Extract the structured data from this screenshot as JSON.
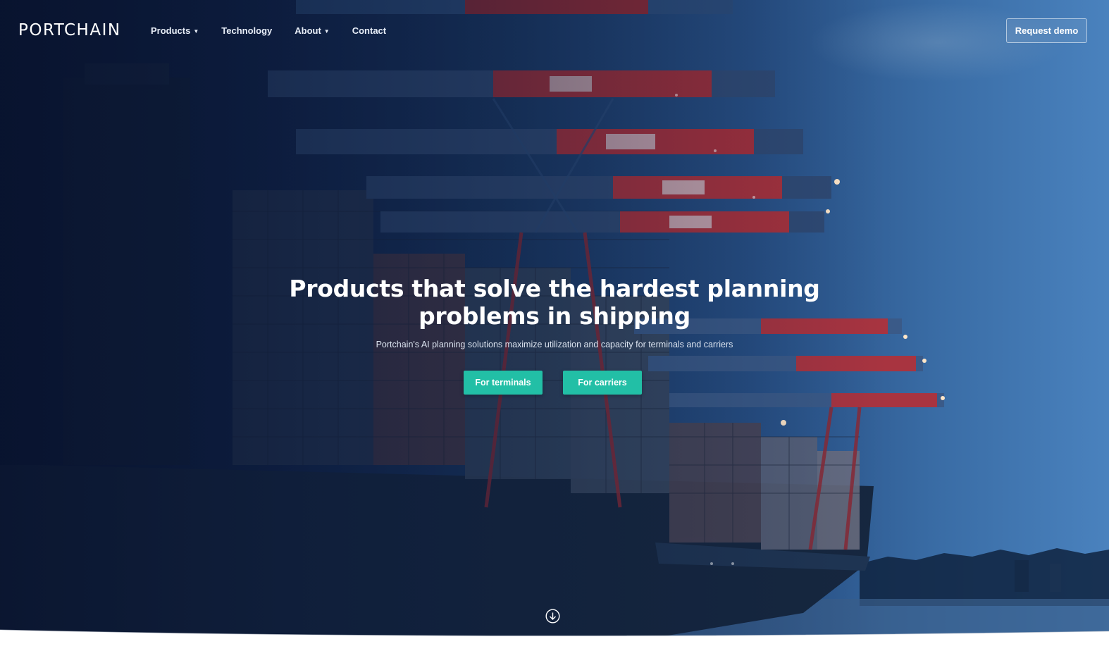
{
  "brand": {
    "logo_text": "PORTCHAIN"
  },
  "nav": {
    "items": [
      {
        "label": "Products",
        "has_dropdown": true
      },
      {
        "label": "Technology",
        "has_dropdown": false
      },
      {
        "label": "About",
        "has_dropdown": true
      },
      {
        "label": "Contact",
        "has_dropdown": false
      }
    ],
    "request_demo_label": "Request demo"
  },
  "hero": {
    "headline_line1": "Products that solve the hardest planning",
    "headline_line2": "problems in shipping",
    "subheadline": "Portchain's AI planning solutions maximize utilization and capacity for terminals and carriers",
    "cta_terminals_label": "For terminals",
    "cta_carriers_label": "For carriers",
    "scroll_icon": "arrow-down-circle-icon"
  },
  "colors": {
    "accent": "#22bfa6",
    "hero_dark": "#0b1936",
    "hero_light": "#4a82be",
    "text": "#ffffff"
  }
}
